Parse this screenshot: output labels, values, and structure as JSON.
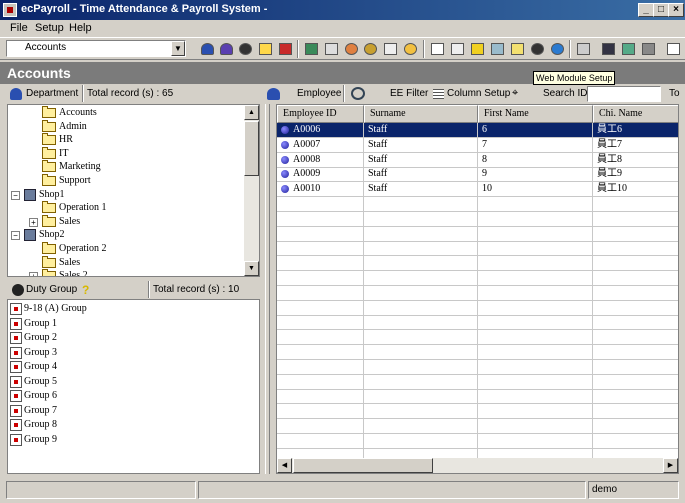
{
  "window": {
    "title": "ecPayroll - Time Attendance & Payroll System -"
  },
  "menu": [
    "File",
    "Setup",
    "Help"
  ],
  "toolbar": {
    "department_selected": "Accounts",
    "tooltip": "Web Module Setup"
  },
  "page": {
    "title": "Accounts"
  },
  "department_panel": {
    "label": "Department",
    "total": "Total record (s) : 65"
  },
  "tree": [
    {
      "label": "Accounts",
      "level": 2,
      "type": "folder"
    },
    {
      "label": "Admin",
      "level": 2,
      "type": "folder"
    },
    {
      "label": "HR",
      "level": 2,
      "type": "folder"
    },
    {
      "label": "IT",
      "level": 2,
      "type": "folder"
    },
    {
      "label": "Marketing",
      "level": 2,
      "type": "folder"
    },
    {
      "label": "Support",
      "level": 2,
      "type": "folder"
    },
    {
      "label": "Shop1",
      "level": 1,
      "type": "shop",
      "expander": "−"
    },
    {
      "label": "Operation 1",
      "level": 2,
      "type": "folder"
    },
    {
      "label": "Sales",
      "level": 2,
      "type": "folder",
      "expander": "+"
    },
    {
      "label": "Shop2",
      "level": 1,
      "type": "shop",
      "expander": "−"
    },
    {
      "label": "Operation 2",
      "level": 2,
      "type": "folder"
    },
    {
      "label": "Sales",
      "level": 2,
      "type": "folder"
    },
    {
      "label": "Sales 2",
      "level": 2,
      "type": "folder",
      "expander": "+"
    }
  ],
  "duty_panel": {
    "label": "Duty Group",
    "total": "Total record (s) : 10"
  },
  "duty_groups": [
    "9-18 (A) Group",
    "Group 1",
    "Group 2",
    "Group 3",
    "Group 4",
    "Group 5",
    "Group 6",
    "Group 7",
    "Group 8",
    "Group 9"
  ],
  "employee_toolbar": {
    "employee": "Employee",
    "ee_filter": "EE Filter",
    "column_setup": "Column Setup",
    "search_label": "Search ID",
    "search_value": "",
    "cut_label": "To"
  },
  "grid": {
    "columns": [
      "Employee ID",
      "Surname",
      "First Name",
      "Chi. Name"
    ],
    "rows": [
      [
        "A0006",
        "Staff",
        "6",
        "員工6"
      ],
      [
        "A0007",
        "Staff",
        "7",
        "員工7"
      ],
      [
        "A0008",
        "Staff",
        "8",
        "員工8"
      ],
      [
        "A0009",
        "Staff",
        "9",
        "員工9"
      ],
      [
        "A0010",
        "Staff",
        "10",
        "員工10"
      ]
    ],
    "selected_row": 0
  },
  "status": {
    "user": "demo"
  }
}
